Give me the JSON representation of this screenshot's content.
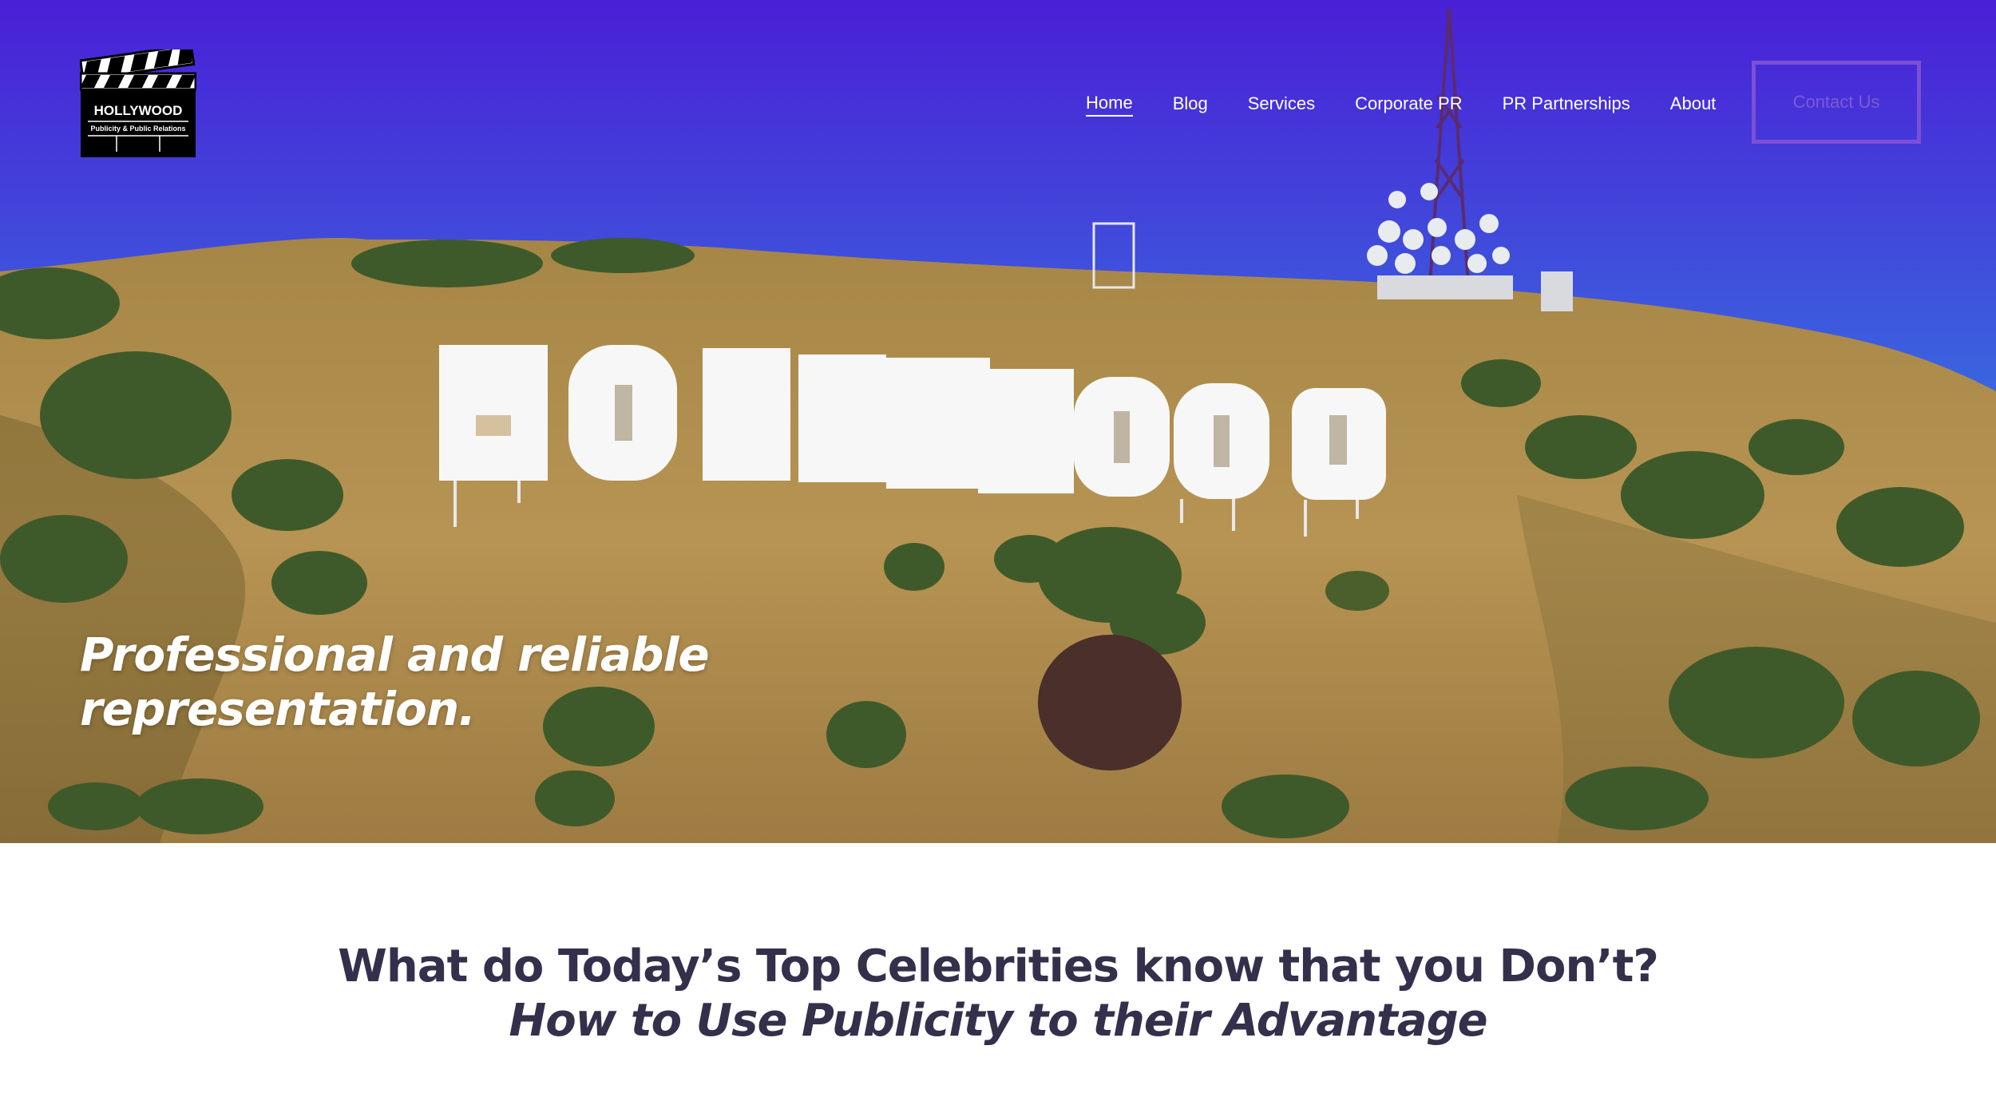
{
  "brand": {
    "logo_title": "HOLLYWOOD",
    "logo_subtitle": "Publicity & Public Relations"
  },
  "nav": {
    "items": [
      {
        "label": "Home",
        "active": true
      },
      {
        "label": "Blog",
        "active": false
      },
      {
        "label": "Services",
        "active": false
      },
      {
        "label": "Corporate PR",
        "active": false
      },
      {
        "label": "PR Partnerships",
        "active": false
      },
      {
        "label": "About",
        "active": false
      }
    ],
    "cta_label": "Contact Us"
  },
  "hero": {
    "sign_text": "HOLLYWOOD",
    "tagline_line1": "Professional and reliable",
    "tagline_line2": "representation."
  },
  "intro": {
    "heading": "What do Today’s Top Celebrities know that you Don’t?",
    "subheading": "How to Use Publicity to their Advantage"
  },
  "colors": {
    "sky_top": "#4a1fd6",
    "sky_bottom": "#3a8ee8",
    "hill": "#b38a4a",
    "text_dark": "#34304b",
    "cta_border": "#7b4fd6"
  }
}
